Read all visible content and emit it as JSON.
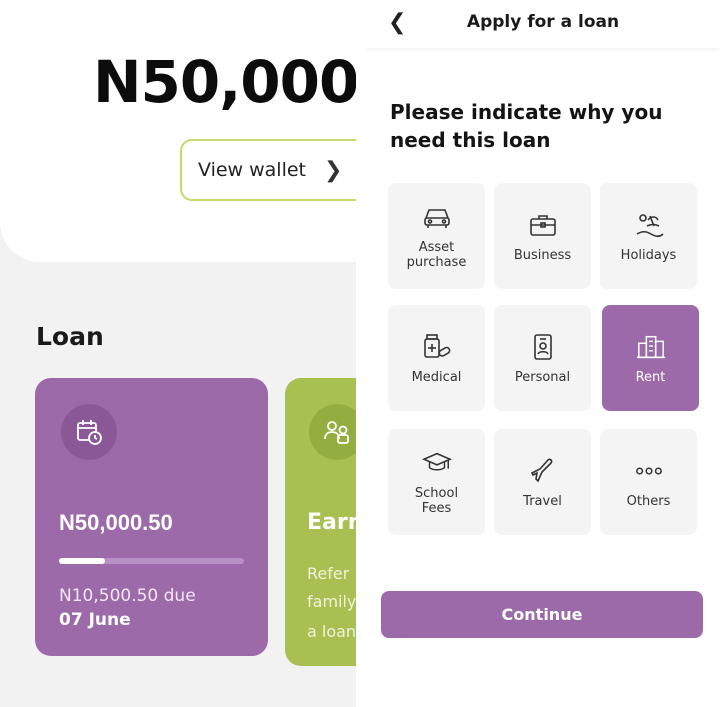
{
  "left_screen": {
    "balance": "N50,000",
    "view_wallet_label": "View wallet",
    "loan_section_title": "Loan",
    "loan_card": {
      "amount": "N50,000.50",
      "repaid_fraction": 0.25,
      "due_text": "N10,500.50 due",
      "due_date": "07 June",
      "accent": "#9d6aa9"
    },
    "earn_card": {
      "title": "Earn",
      "lines": [
        "Refer",
        "family",
        "a loan"
      ],
      "accent": "#a8bf52"
    }
  },
  "right_screen": {
    "header_title": "Apply for a loan",
    "question": "Please indicate why you need this loan",
    "reasons": [
      {
        "label": "Asset purchase",
        "icon": "car-icon",
        "selected": false
      },
      {
        "label": "Business",
        "icon": "briefcase-icon",
        "selected": false
      },
      {
        "label": "Holidays",
        "icon": "beach-icon",
        "selected": false
      },
      {
        "label": "Medical",
        "icon": "medicine-icon",
        "selected": false
      },
      {
        "label": "Personal",
        "icon": "id-badge-icon",
        "selected": false
      },
      {
        "label": "Rent",
        "icon": "buildings-icon",
        "selected": true
      },
      {
        "label": "School Fees",
        "icon": "graduation-cap-icon",
        "selected": false
      },
      {
        "label": "Travel",
        "icon": "airplane-icon",
        "selected": false
      },
      {
        "label": "Others",
        "icon": "dots-icon",
        "selected": false
      }
    ],
    "continue_label": "Continue",
    "accent": "#9d6aa9"
  }
}
